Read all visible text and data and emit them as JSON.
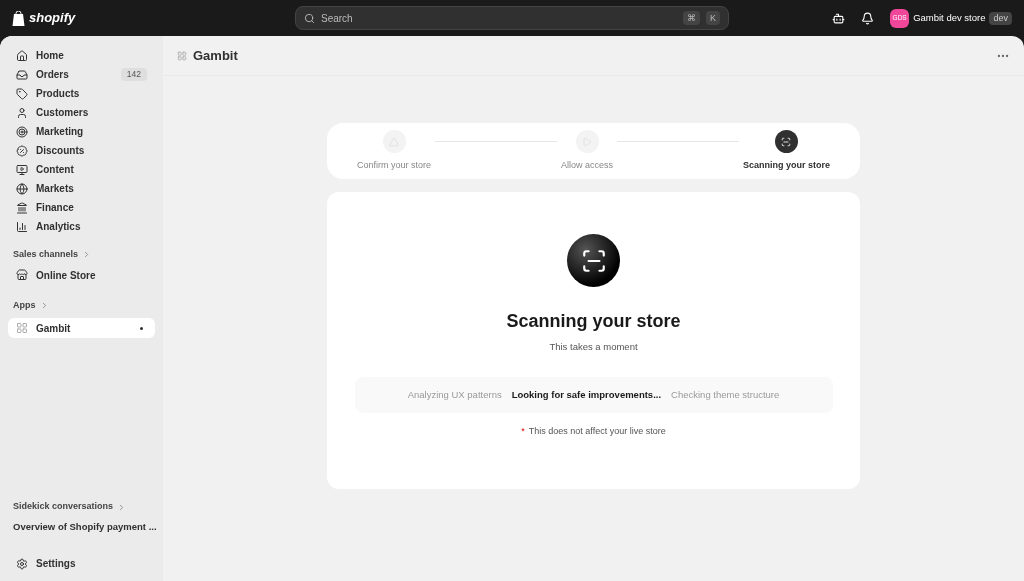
{
  "topbar": {
    "logo": "shopify",
    "search": {
      "placeholder": "Search",
      "keys": [
        "⌘",
        "K"
      ]
    },
    "store": {
      "initials": "GDS",
      "name": "Gambit dev store",
      "badge": "dev"
    }
  },
  "sidebar": {
    "items": [
      {
        "label": "Home",
        "kind": "home",
        "selected": false
      },
      {
        "label": "Orders",
        "kind": "orders",
        "selected": false,
        "count": "142"
      },
      {
        "label": "Products",
        "kind": "products",
        "selected": false
      },
      {
        "label": "Customers",
        "kind": "customers",
        "selected": false
      },
      {
        "label": "Marketing",
        "kind": "marketing",
        "selected": false
      },
      {
        "label": "Discounts",
        "kind": "discounts",
        "selected": false
      },
      {
        "label": "Content",
        "kind": "content",
        "selected": false
      },
      {
        "label": "Markets",
        "kind": "markets",
        "selected": false
      },
      {
        "label": "Finance",
        "kind": "finance",
        "selected": false
      },
      {
        "label": "Analytics",
        "kind": "analytics",
        "selected": false
      }
    ],
    "sales_channels": {
      "heading": "Sales channels",
      "items": [
        {
          "label": "Online Store",
          "kind": "store",
          "selected": false
        }
      ]
    },
    "apps": {
      "heading": "Apps",
      "items": [
        {
          "label": "Gambit",
          "kind": "app",
          "selected": true
        }
      ]
    },
    "sidekick": {
      "heading": "Sidekick conversations",
      "items": [
        {
          "label": "Overview of Shopify payment ..."
        }
      ]
    },
    "settings": {
      "label": "Settings"
    }
  },
  "page": {
    "title": "Gambit",
    "steps": [
      {
        "label": "Confirm your store",
        "kind": "triangle",
        "selected": false
      },
      {
        "label": "Allow access",
        "kind": "play",
        "selected": false
      },
      {
        "label": "Scanning your store",
        "kind": "scan",
        "selected": true
      }
    ],
    "heading": "Scanning your store",
    "subheading": "This takes a moment",
    "phases": [
      {
        "label": "Analyzing UX patterns",
        "selected": false
      },
      {
        "label": "Looking for safe improvements...",
        "selected": true
      },
      {
        "label": "Checking theme structure",
        "selected": false
      }
    ],
    "note": {
      "mark": "*",
      "text": "This does not affect your live store"
    }
  }
}
